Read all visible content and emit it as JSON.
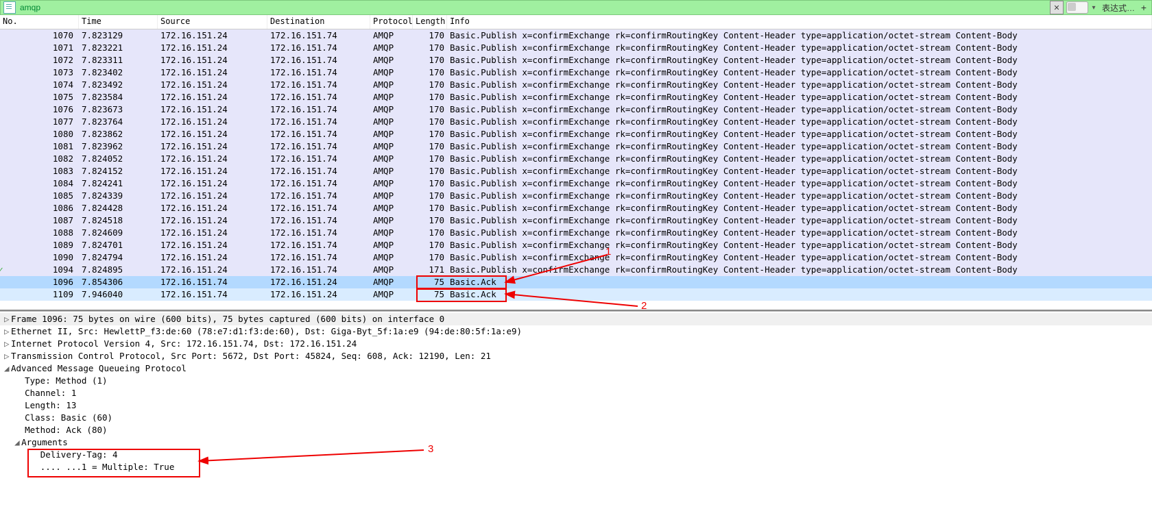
{
  "filter": {
    "value": "amqp",
    "expr_label": "表达式…",
    "clear_glyph": "✕",
    "plus": "+"
  },
  "columns": {
    "no": "No.",
    "time": "Time",
    "source": "Source",
    "destination": "Destination",
    "protocol": "Protocol",
    "length": "Length",
    "info": "Info"
  },
  "info_publish": "Basic.Publish x=confirmExchange rk=confirmRoutingKey Content-Header type=application/octet-stream Content-Body",
  "info_ack": "Basic.Ack",
  "packets": [
    {
      "no": 1070,
      "time": "7.823129",
      "src": "172.16.151.24",
      "dst": "172.16.151.74",
      "proto": "AMQP",
      "len": 170,
      "kind": "pub"
    },
    {
      "no": 1071,
      "time": "7.823221",
      "src": "172.16.151.24",
      "dst": "172.16.151.74",
      "proto": "AMQP",
      "len": 170,
      "kind": "pub"
    },
    {
      "no": 1072,
      "time": "7.823311",
      "src": "172.16.151.24",
      "dst": "172.16.151.74",
      "proto": "AMQP",
      "len": 170,
      "kind": "pub"
    },
    {
      "no": 1073,
      "time": "7.823402",
      "src": "172.16.151.24",
      "dst": "172.16.151.74",
      "proto": "AMQP",
      "len": 170,
      "kind": "pub"
    },
    {
      "no": 1074,
      "time": "7.823492",
      "src": "172.16.151.24",
      "dst": "172.16.151.74",
      "proto": "AMQP",
      "len": 170,
      "kind": "pub"
    },
    {
      "no": 1075,
      "time": "7.823584",
      "src": "172.16.151.24",
      "dst": "172.16.151.74",
      "proto": "AMQP",
      "len": 170,
      "kind": "pub"
    },
    {
      "no": 1076,
      "time": "7.823673",
      "src": "172.16.151.24",
      "dst": "172.16.151.74",
      "proto": "AMQP",
      "len": 170,
      "kind": "pub"
    },
    {
      "no": 1077,
      "time": "7.823764",
      "src": "172.16.151.24",
      "dst": "172.16.151.74",
      "proto": "AMQP",
      "len": 170,
      "kind": "pub"
    },
    {
      "no": 1080,
      "time": "7.823862",
      "src": "172.16.151.24",
      "dst": "172.16.151.74",
      "proto": "AMQP",
      "len": 170,
      "kind": "pub"
    },
    {
      "no": 1081,
      "time": "7.823962",
      "src": "172.16.151.24",
      "dst": "172.16.151.74",
      "proto": "AMQP",
      "len": 170,
      "kind": "pub"
    },
    {
      "no": 1082,
      "time": "7.824052",
      "src": "172.16.151.24",
      "dst": "172.16.151.74",
      "proto": "AMQP",
      "len": 170,
      "kind": "pub"
    },
    {
      "no": 1083,
      "time": "7.824152",
      "src": "172.16.151.24",
      "dst": "172.16.151.74",
      "proto": "AMQP",
      "len": 170,
      "kind": "pub"
    },
    {
      "no": 1084,
      "time": "7.824241",
      "src": "172.16.151.24",
      "dst": "172.16.151.74",
      "proto": "AMQP",
      "len": 170,
      "kind": "pub"
    },
    {
      "no": 1085,
      "time": "7.824339",
      "src": "172.16.151.24",
      "dst": "172.16.151.74",
      "proto": "AMQP",
      "len": 170,
      "kind": "pub"
    },
    {
      "no": 1086,
      "time": "7.824428",
      "src": "172.16.151.24",
      "dst": "172.16.151.74",
      "proto": "AMQP",
      "len": 170,
      "kind": "pub"
    },
    {
      "no": 1087,
      "time": "7.824518",
      "src": "172.16.151.24",
      "dst": "172.16.151.74",
      "proto": "AMQP",
      "len": 170,
      "kind": "pub"
    },
    {
      "no": 1088,
      "time": "7.824609",
      "src": "172.16.151.24",
      "dst": "172.16.151.74",
      "proto": "AMQP",
      "len": 170,
      "kind": "pub"
    },
    {
      "no": 1089,
      "time": "7.824701",
      "src": "172.16.151.24",
      "dst": "172.16.151.74",
      "proto": "AMQP",
      "len": 170,
      "kind": "pub"
    },
    {
      "no": 1090,
      "time": "7.824794",
      "src": "172.16.151.24",
      "dst": "172.16.151.74",
      "proto": "AMQP",
      "len": 170,
      "kind": "pub"
    },
    {
      "no": 1094,
      "time": "7.824895",
      "src": "172.16.151.24",
      "dst": "172.16.151.74",
      "proto": "AMQP",
      "len": 171,
      "kind": "pub",
      "mark": true
    },
    {
      "no": 1096,
      "time": "7.854306",
      "src": "172.16.151.74",
      "dst": "172.16.151.24",
      "proto": "AMQP",
      "len": 75,
      "kind": "ack",
      "sel": true
    },
    {
      "no": 1109,
      "time": "7.946040",
      "src": "172.16.151.74",
      "dst": "172.16.151.24",
      "proto": "AMQP",
      "len": 75,
      "kind": "ack"
    }
  ],
  "detail": {
    "frame": "Frame 1096: 75 bytes on wire (600 bits), 75 bytes captured (600 bits) on interface 0",
    "eth": "Ethernet II, Src: HewlettP_f3:de:60 (78:e7:d1:f3:de:60), Dst: Giga-Byt_5f:1a:e9 (94:de:80:5f:1a:e9)",
    "ip": "Internet Protocol Version 4, Src: 172.16.151.74, Dst: 172.16.151.24",
    "tcp": "Transmission Control Protocol, Src Port: 5672, Dst Port: 45824, Seq: 608, Ack: 12190, Len: 21",
    "amqp": "Advanced Message Queueing Protocol",
    "type": "Type: Method (1)",
    "channel": "Channel: 1",
    "length": "Length: 13",
    "class": "Class: Basic (60)",
    "method": "Method: Ack (80)",
    "args": "Arguments",
    "dtag": "Delivery-Tag: 4",
    "mult": ".... ...1 = Multiple: True"
  },
  "annot": {
    "n1": "1",
    "n2": "2",
    "n3": "3"
  }
}
